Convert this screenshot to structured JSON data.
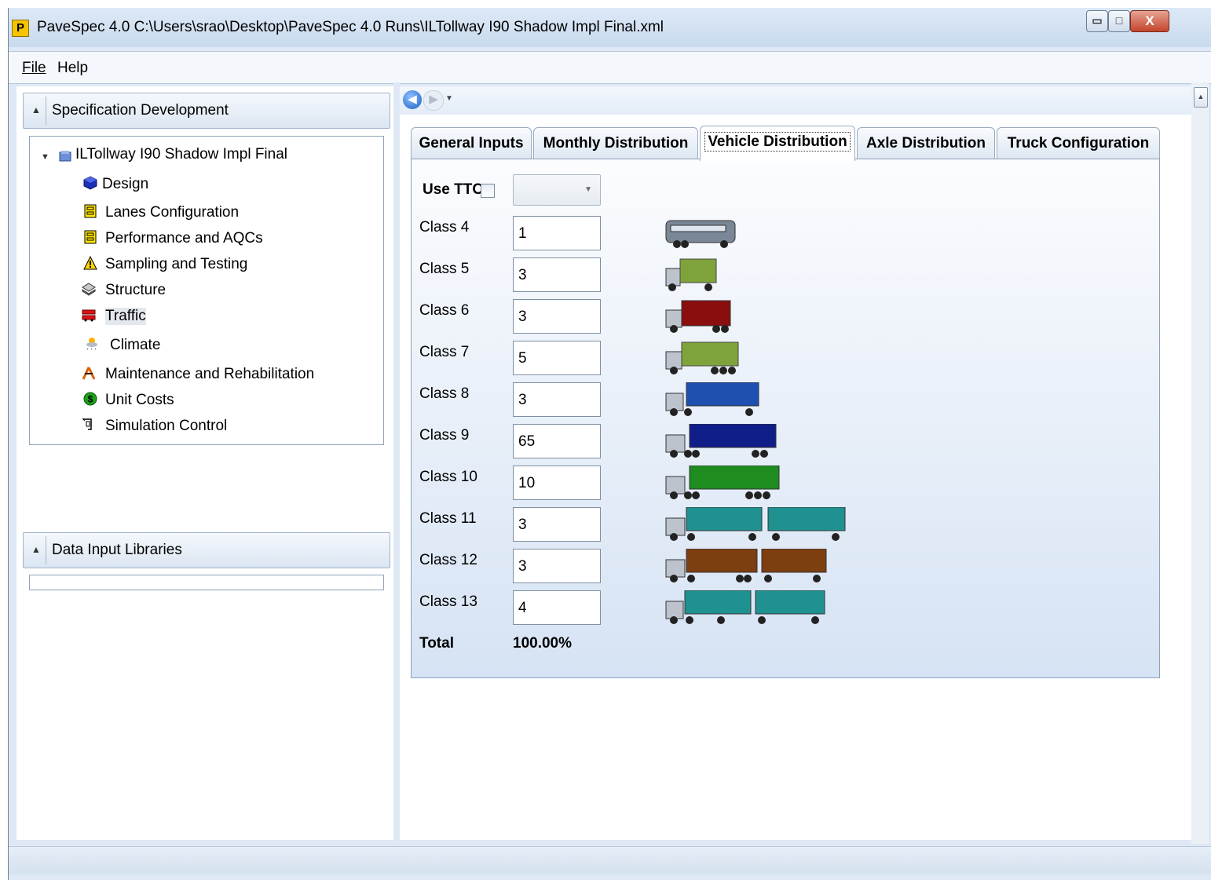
{
  "window": {
    "title": "PaveSpec 4.0  C:\\Users\\srao\\Desktop\\PaveSpec 4.0 Runs\\ILTollway I90 Shadow Impl Final.xml",
    "app_icon_letter": "P",
    "minimize_glyph": "▭",
    "maximize_glyph": "□",
    "close_glyph": "X"
  },
  "menu": {
    "file": "File",
    "help": "Help"
  },
  "sidebar": {
    "spec_header": "Specification Development",
    "project_name": "ILTollway I90 Shadow Impl Final",
    "items": [
      {
        "label": "Design",
        "icon": "cube-icon"
      },
      {
        "label": "Lanes Configuration",
        "icon": "lanes-icon"
      },
      {
        "label": "Performance and AQCs",
        "icon": "performance-icon"
      },
      {
        "label": "Sampling and Testing",
        "icon": "warning-icon"
      },
      {
        "label": "Structure",
        "icon": "layers-icon"
      },
      {
        "label": "Traffic",
        "icon": "traffic-icon"
      },
      {
        "label": "Climate",
        "icon": "climate-icon"
      },
      {
        "label": "Maintenance and Rehabilitation",
        "icon": "maintenance-icon"
      },
      {
        "label": "Unit Costs",
        "icon": "dollar-icon"
      },
      {
        "label": "Simulation Control",
        "icon": "simulation-icon"
      }
    ],
    "library_header": "Data Input Libraries"
  },
  "tabs": [
    "General Inputs",
    "Monthly Distribution",
    "Vehicle Distribution",
    "Axle Distribution",
    "Truck Configuration"
  ],
  "active_tab": "Vehicle Distribution",
  "vehicle_distribution": {
    "use_ttc_label": "Use TTC",
    "use_ttc_checked": false,
    "ttc_selected": "",
    "classes": [
      {
        "label": "Class 4",
        "value": "1",
        "color": "#7a8797"
      },
      {
        "label": "Class 5",
        "value": "3",
        "color": "#7fa33a"
      },
      {
        "label": "Class 6",
        "value": "3",
        "color": "#8a0e0e"
      },
      {
        "label": "Class 7",
        "value": "5",
        "color": "#7fa33a"
      },
      {
        "label": "Class 8",
        "value": "3",
        "color": "#1f4fb0"
      },
      {
        "label": "Class 9",
        "value": "65",
        "color": "#101e8a"
      },
      {
        "label": "Class 10",
        "value": "10",
        "color": "#1e8c1e"
      },
      {
        "label": "Class 11",
        "value": "3",
        "color": "#1f9191"
      },
      {
        "label": "Class 12",
        "value": "3",
        "color": "#7d3e10"
      },
      {
        "label": "Class 13",
        "value": "4",
        "color": "#1f9191"
      }
    ],
    "total_label": "Total",
    "total_value": "100.00%"
  }
}
